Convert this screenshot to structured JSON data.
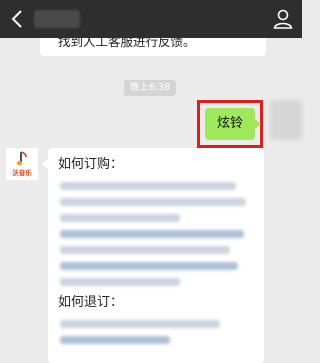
{
  "header": {
    "back_icon": "chevron-left-icon",
    "profile_icon": "person-icon"
  },
  "messages": {
    "top_partial_text": "找到人工客服进行反馈。",
    "timestamp": "晚上6:38",
    "outgoing_text": "炫铃",
    "bot_brand": "沃音乐",
    "sections": [
      {
        "title": "如何订购："
      },
      {
        "title": "如何退订："
      }
    ]
  },
  "colors": {
    "header_bg": "#2e2e2e",
    "chat_bg": "#ebebeb",
    "outgoing_bubble": "#9fe75b",
    "highlight_border": "#d9201c"
  }
}
